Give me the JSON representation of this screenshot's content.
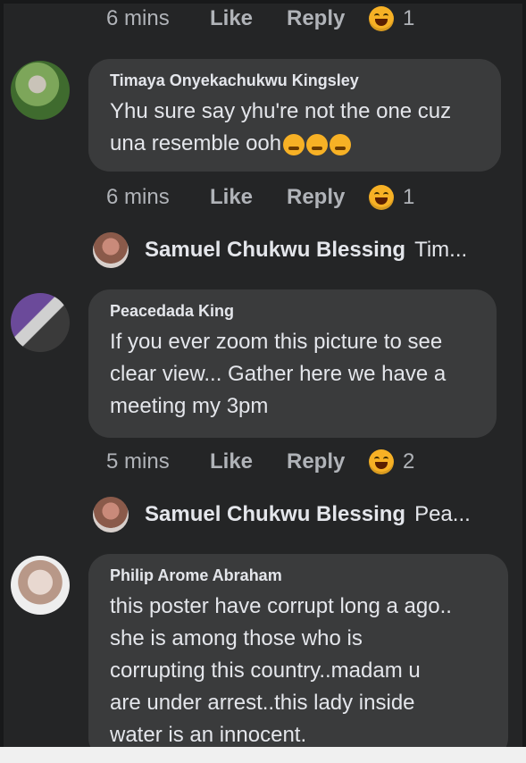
{
  "comments": [
    {
      "time": "6 mins",
      "like": "Like",
      "reply": "Reply",
      "reactions": "1"
    },
    {
      "name": "Timaya Onyekachukwu Kingsley",
      "text_line1": "Yhu sure say yhu're not the one cuz",
      "text_line2": "una resemble ooh",
      "time": "6 mins",
      "like": "Like",
      "reply": "Reply",
      "reactions": "1",
      "reply_preview": {
        "name": "Samuel Chukwu Blessing",
        "snippet": "Tim..."
      }
    },
    {
      "name": "Peacedada King",
      "text": [
        "If you ever zoom this picture to see",
        "clear view... Gather here we have a",
        "meeting my 3pm"
      ],
      "time": "5 mins",
      "like": "Like",
      "reply": "Reply",
      "reactions": "2",
      "reply_preview": {
        "name": "Samuel Chukwu Blessing",
        "snippet": "Pea..."
      }
    },
    {
      "name": "Philip Arome Abraham",
      "text": [
        "this poster have corrupt long a ago..",
        "she is among those who is",
        "corrupting this country..madam u",
        "are under arrest..this lady inside",
        "water is an innocent."
      ]
    }
  ],
  "colors": {
    "background": "#242526",
    "bubble": "#3a3b3c",
    "meta": "#b0b3b8",
    "text": "#e4e6eb",
    "reaction": "#f7b125"
  }
}
